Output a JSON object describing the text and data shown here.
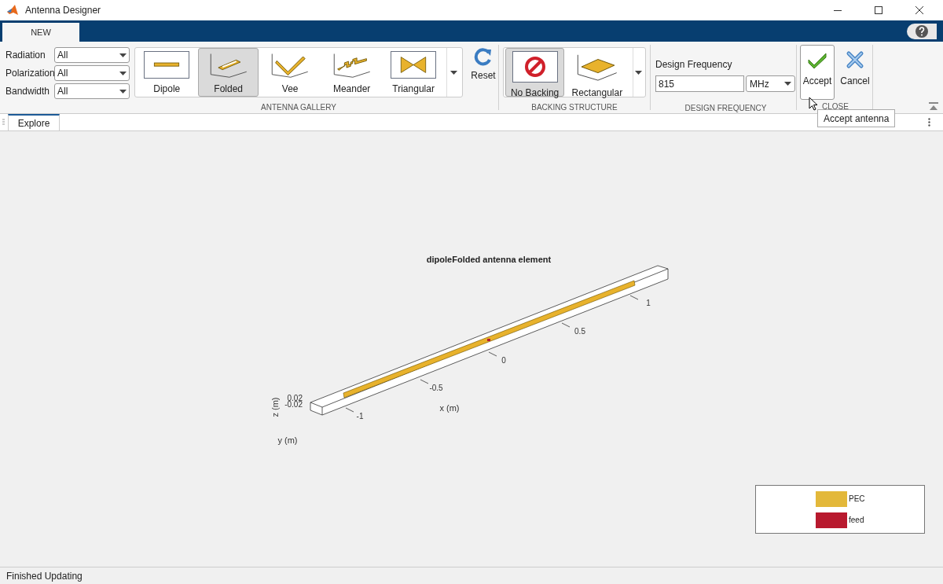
{
  "window": {
    "title": "Antenna Designer"
  },
  "ribbon_tabs": [
    {
      "label": "NEW",
      "selected": true
    }
  ],
  "filters": [
    {
      "label": "Radiation",
      "value": "All"
    },
    {
      "label": "Polarization",
      "value": "All"
    },
    {
      "label": "Bandwidth",
      "value": "All"
    }
  ],
  "antenna_gallery": {
    "label": "ANTENNA GALLERY",
    "items": [
      {
        "label": "Dipole",
        "kind": "dipole",
        "selected": false
      },
      {
        "label": "Folded",
        "kind": "folded",
        "selected": true
      },
      {
        "label": "Vee",
        "kind": "vee",
        "selected": false
      },
      {
        "label": "Meander",
        "kind": "meander",
        "selected": false
      },
      {
        "label": "Triangular",
        "kind": "triangular",
        "selected": false
      }
    ]
  },
  "reset": {
    "label": "Reset"
  },
  "backing_structure": {
    "label": "BACKING STRUCTURE",
    "items": [
      {
        "label": "No Backing",
        "kind": "none",
        "selected": true
      },
      {
        "label": "Rectangular",
        "kind": "rectangular",
        "selected": false
      }
    ]
  },
  "design_frequency": {
    "label": "DESIGN FREQUENCY",
    "field_label": "Design Frequency",
    "value": "815",
    "unit": "MHz"
  },
  "close": {
    "label": "CLOSE",
    "buttons": [
      {
        "label": "Accept",
        "kind": "accept",
        "hovered": true
      },
      {
        "label": "Cancel",
        "kind": "cancel",
        "hovered": false
      }
    ]
  },
  "tooltip": "Accept antenna",
  "document_tabs": [
    {
      "label": "Explore",
      "selected": true
    }
  ],
  "plot": {
    "title": "dipoleFolded antenna element",
    "x_ticks": [
      "-1",
      "-0.5",
      "0",
      "0.5",
      "1"
    ],
    "z_ticks": [
      "0.02",
      "-0.02"
    ],
    "xlabel": "x (m)",
    "ylabel": "y (m)",
    "zlabel": "z (m)"
  },
  "legend": [
    {
      "label": "PEC",
      "color": "#e3b83a"
    },
    {
      "label": "feed",
      "color": "#b8192e"
    }
  ],
  "status_bar": "Finished Updating"
}
